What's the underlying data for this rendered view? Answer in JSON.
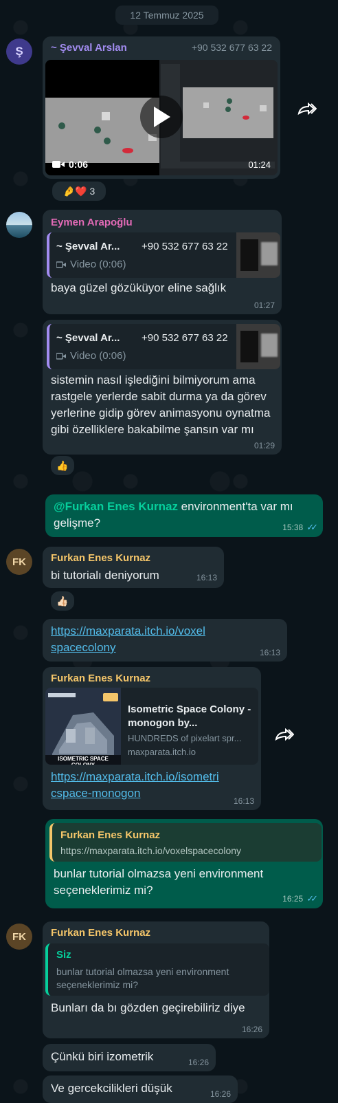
{
  "date": "12 Temmuz 2025",
  "colors": {
    "accent_link": "#53bdeb",
    "outgoing_bubble": "#005c4b",
    "incoming_bubble": "#202c33",
    "name_sevval": "#a28cf0",
    "name_eymen": "#e26ab6",
    "name_furkan": "#f5c66a"
  },
  "msg1": {
    "avatar_letter": "Ş",
    "sender": "~ Şevval Arslan",
    "phone": "+90 532 677 63 22",
    "video_duration": "0:06",
    "time": "01:24",
    "reactions": {
      "emojis": "🤌❤️",
      "count": "3"
    }
  },
  "msg2": {
    "sender": "Eymen Arapoğlu",
    "quote_sender": "~ Şevval Ar...",
    "quote_phone": "+90 532 677 63 22",
    "quote_type": "Video (0:06)",
    "text": "baya güzel gözüküyor eline sağlık",
    "time": "01:27"
  },
  "msg3": {
    "quote_sender": "~ Şevval Ar...",
    "quote_phone": "+90 532 677 63 22",
    "quote_type": "Video (0:06)",
    "text": "sistemin nasıl işlediğini bilmiyorum ama rastgele yerlerde sabit durma ya da görev yerlerine gidip görev animasyonu oynatma gibi özelliklere bakabilme şansın var mı",
    "time": "01:29",
    "reaction": "👍"
  },
  "msg4": {
    "mention": "@Furkan Enes Kurnaz",
    "text": " environment'ta var mı gelişme?",
    "time": "15:38",
    "ticks": "✓✓"
  },
  "msg5": {
    "avatar_letters": "FK",
    "sender": "Furkan Enes Kurnaz",
    "text": "bi tutorialı deniyorum",
    "time": "16:13",
    "reaction": "👍🏻"
  },
  "msg6": {
    "link": "https://maxparata.itch.io/voxelspacecolony",
    "time": "16:13"
  },
  "msg7": {
    "sender": "Furkan Enes Kurnaz",
    "preview_title": "Isometric Space Colony - monogon by...",
    "preview_desc": "HUNDREDS of pixelart spr...",
    "preview_domain": "maxparata.itch.io",
    "thumb_caption": "ISOMETRIC SPACE COLONY",
    "link": "https://maxparata.itch.io/isometricspace-monogon",
    "time": "16:13"
  },
  "msg8": {
    "quote_sender": "Furkan Enes Kurnaz",
    "quote_text": "https://maxparata.itch.io/voxelspacecolony",
    "text": "bunlar tutorial olmazsa yeni environment seçeneklerimiz mi?",
    "time": "16:25",
    "ticks": "✓✓"
  },
  "msg9": {
    "avatar_letters": "FK",
    "sender": "Furkan Enes Kurnaz",
    "quote_sender": "Siz",
    "quote_text": "bunlar tutorial olmazsa yeni environment seçeneklerimiz mi?",
    "text": "Bunları da bı gözden geçirebiliriz diye",
    "time": "16:26"
  },
  "msg10": {
    "text": "Çünkü biri izometrik",
    "time": "16:26"
  },
  "msg11": {
    "text": "Ve gercekcilikleri düşük",
    "time": "16:26"
  }
}
